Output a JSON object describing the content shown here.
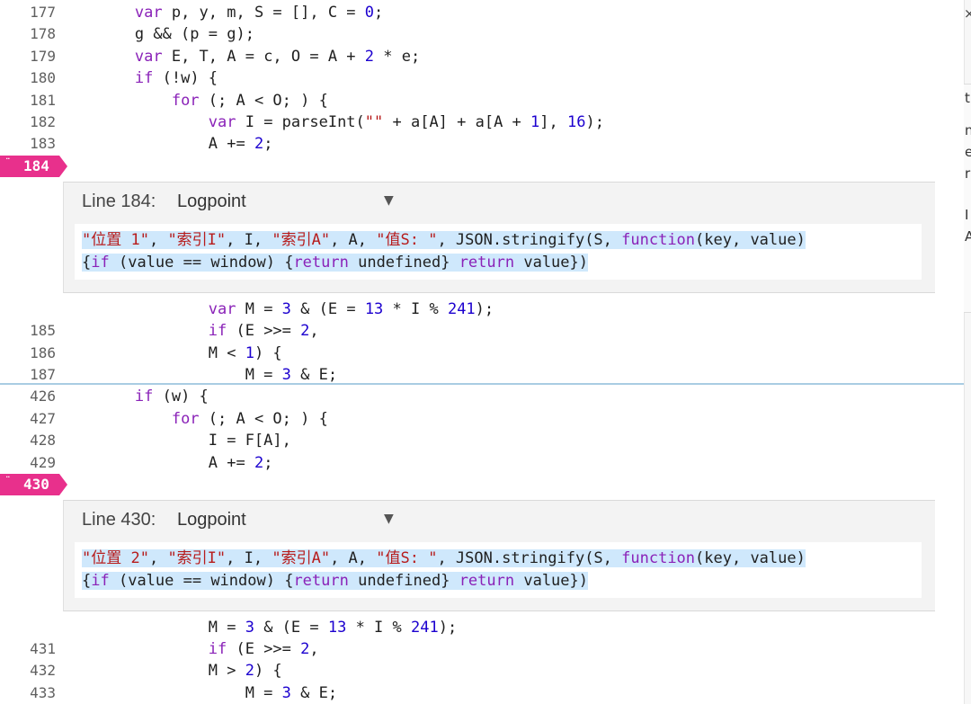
{
  "top_lines": [
    {
      "num": "177",
      "tokens": [
        [
          "pl",
          "        "
        ],
        [
          "kw",
          "var"
        ],
        [
          "pl",
          " p, y, m, S = [], C = "
        ],
        [
          "num",
          "0"
        ],
        [
          "pl",
          ";"
        ]
      ]
    },
    {
      "num": "178",
      "tokens": [
        [
          "pl",
          "        g && (p = g);"
        ]
      ]
    },
    {
      "num": "179",
      "tokens": [
        [
          "pl",
          "        "
        ],
        [
          "kw",
          "var"
        ],
        [
          "pl",
          " E, T, A = c, O = A + "
        ],
        [
          "num",
          "2"
        ],
        [
          "pl",
          " * e;"
        ]
      ]
    },
    {
      "num": "180",
      "tokens": [
        [
          "pl",
          "        "
        ],
        [
          "kw",
          "if"
        ],
        [
          "pl",
          " (!w) {"
        ]
      ]
    },
    {
      "num": "181",
      "tokens": [
        [
          "pl",
          "            "
        ],
        [
          "kw",
          "for"
        ],
        [
          "pl",
          " (; A < O; ) {"
        ]
      ]
    },
    {
      "num": "182",
      "tokens": [
        [
          "pl",
          "                "
        ],
        [
          "kw",
          "var"
        ],
        [
          "pl",
          " I = parseInt("
        ],
        [
          "str",
          "\"\""
        ],
        [
          "pl",
          " + a[A] + a[A + "
        ],
        [
          "num",
          "1"
        ],
        [
          "pl",
          "], "
        ],
        [
          "num",
          "16"
        ],
        [
          "pl",
          ");"
        ]
      ]
    },
    {
      "num": "183",
      "tokens": [
        [
          "pl",
          "                A += "
        ],
        [
          "num",
          "2"
        ],
        [
          "pl",
          ";"
        ]
      ]
    }
  ],
  "breakpoint1": {
    "num": "184",
    "dots": "¨"
  },
  "logpoint1": {
    "title": "Line 184:",
    "type": "Logpoint",
    "line1": [
      [
        "str",
        "\"位置 1\""
      ],
      [
        "pl",
        ", "
      ],
      [
        "str",
        "\"索引I\""
      ],
      [
        "pl",
        ", I, "
      ],
      [
        "str",
        "\"索引A\""
      ],
      [
        "pl",
        ", A, "
      ],
      [
        "str",
        "\"值S: \""
      ],
      [
        "pl",
        ", JSON.stringify(S, "
      ],
      [
        "kw",
        "function"
      ],
      [
        "pl",
        "(key, value)"
      ]
    ],
    "line2": [
      [
        "pl",
        "{"
      ],
      [
        "kw",
        "if"
      ],
      [
        "pl",
        " (value == window) {"
      ],
      [
        "kw",
        "return"
      ],
      [
        "pl",
        " undefined} "
      ],
      [
        "kw",
        "return"
      ],
      [
        "pl",
        " value})"
      ]
    ]
  },
  "mid_lines": [
    {
      "num": "",
      "tokens": [
        [
          "pl",
          "                "
        ],
        [
          "kw",
          "var"
        ],
        [
          "pl",
          " M = "
        ],
        [
          "num",
          "3"
        ],
        [
          "pl",
          " & (E = "
        ],
        [
          "num",
          "13"
        ],
        [
          "pl",
          " * I % "
        ],
        [
          "num",
          "241"
        ],
        [
          "pl",
          ");"
        ]
      ]
    },
    {
      "num": "185",
      "tokens": [
        [
          "pl",
          "                "
        ],
        [
          "kw",
          "if"
        ],
        [
          "pl",
          " (E >>= "
        ],
        [
          "num",
          "2"
        ],
        [
          "pl",
          ","
        ]
      ]
    },
    {
      "num": "186",
      "tokens": [
        [
          "pl",
          "                M < "
        ],
        [
          "num",
          "1"
        ],
        [
          "pl",
          ") {"
        ]
      ]
    },
    {
      "num": "187",
      "tokens": [
        [
          "pl",
          "                    M = "
        ],
        [
          "num",
          "3"
        ],
        [
          "pl",
          " & E;"
        ]
      ]
    }
  ],
  "lower_lines": [
    {
      "num": "426",
      "tokens": [
        [
          "pl",
          "        "
        ],
        [
          "kw",
          "if"
        ],
        [
          "pl",
          " (w) {"
        ]
      ]
    },
    {
      "num": "427",
      "tokens": [
        [
          "pl",
          "            "
        ],
        [
          "kw",
          "for"
        ],
        [
          "pl",
          " (; A < O; ) {"
        ]
      ]
    },
    {
      "num": "428",
      "tokens": [
        [
          "pl",
          "                I = F[A],"
        ]
      ]
    },
    {
      "num": "429",
      "tokens": [
        [
          "pl",
          "                A += "
        ],
        [
          "num",
          "2"
        ],
        [
          "pl",
          ";"
        ]
      ]
    }
  ],
  "breakpoint2": {
    "num": "430",
    "dots": "¨"
  },
  "logpoint2": {
    "title": "Line 430:",
    "type": "Logpoint",
    "line1": [
      [
        "str",
        "\"位置 2\""
      ],
      [
        "pl",
        ", "
      ],
      [
        "str",
        "\"索引I\""
      ],
      [
        "pl",
        ", I, "
      ],
      [
        "str",
        "\"索引A\""
      ],
      [
        "pl",
        ", A, "
      ],
      [
        "str",
        "\"值S: \""
      ],
      [
        "pl",
        ", JSON.stringify(S, "
      ],
      [
        "kw",
        "function"
      ],
      [
        "pl",
        "(key, value)"
      ]
    ],
    "line2": [
      [
        "pl",
        "{"
      ],
      [
        "kw",
        "if"
      ],
      [
        "pl",
        " (value == window) {"
      ],
      [
        "kw",
        "return"
      ],
      [
        "pl",
        " undefined} "
      ],
      [
        "kw",
        "return"
      ],
      [
        "pl",
        " value})"
      ]
    ]
  },
  "bottom_lines": [
    {
      "num": "",
      "tokens": [
        [
          "pl",
          "                M = "
        ],
        [
          "num",
          "3"
        ],
        [
          "pl",
          " & (E = "
        ],
        [
          "num",
          "13"
        ],
        [
          "pl",
          " * I % "
        ],
        [
          "num",
          "241"
        ],
        [
          "pl",
          ");"
        ]
      ]
    },
    {
      "num": "431",
      "tokens": [
        [
          "pl",
          "                "
        ],
        [
          "kw",
          "if"
        ],
        [
          "pl",
          " (E >>= "
        ],
        [
          "num",
          "2"
        ],
        [
          "pl",
          ","
        ]
      ]
    },
    {
      "num": "432",
      "tokens": [
        [
          "pl",
          "                M > "
        ],
        [
          "num",
          "2"
        ],
        [
          "pl",
          ") {"
        ]
      ]
    },
    {
      "num": "433",
      "tokens": [
        [
          "pl",
          "                    M = "
        ],
        [
          "num",
          "3"
        ],
        [
          "pl",
          " & E;"
        ]
      ]
    }
  ],
  "side_fragments": [
    "t",
    "n",
    "e",
    "r",
    "I",
    "A"
  ],
  "close_glyph": "×",
  "caret_glyph": "▼",
  "colors": {
    "breakpoint": "#e8308c",
    "keyword": "#8a22b8",
    "number": "#1c00cf",
    "string": "#b71c1c",
    "highlight": "#cfe8fc"
  }
}
